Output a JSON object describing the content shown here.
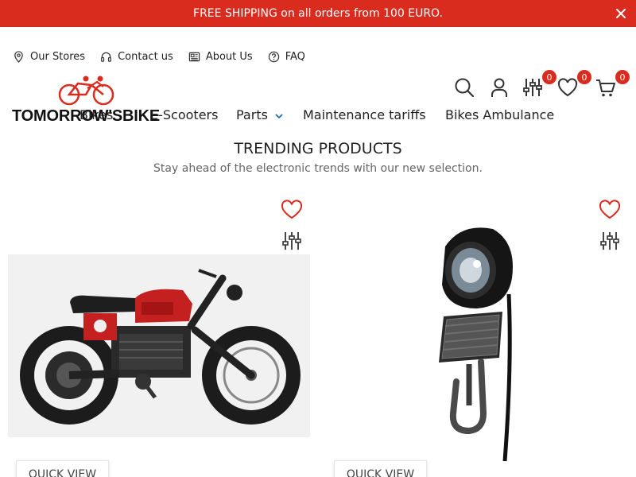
{
  "promo": {
    "text": "FREE SHIPPING on all orders from 100 EURO."
  },
  "top_links": [
    {
      "label": "Our Stores",
      "icon": "map-pin-icon"
    },
    {
      "label": "Contact us",
      "icon": "headphones-icon"
    },
    {
      "label": "About Us",
      "icon": "newspaper-icon"
    },
    {
      "label": "FAQ",
      "icon": "question-circle-icon"
    }
  ],
  "logo": {
    "text": "TOMORROW'SBIKE"
  },
  "nav": {
    "items": [
      "Bikes",
      "E-Scooters",
      "Parts",
      "Maintenance tariffs",
      "Bikes Ambulance"
    ]
  },
  "header_icons": {
    "compare_count": "0",
    "wishlist_count": "0",
    "cart_count": "0"
  },
  "trending": {
    "title": "TRENDING PRODUCTS",
    "subtitle": "Stay ahead of the electronic trends with our new selection."
  },
  "products": [
    {
      "quick_view_label": "QUICK VIEW",
      "image": "electric-motorbike-image"
    },
    {
      "quick_view_label": "QUICK VIEW",
      "image": "bike-headlight-image"
    }
  ],
  "colors": {
    "accent": "#d92b1e",
    "text": "#222222"
  }
}
